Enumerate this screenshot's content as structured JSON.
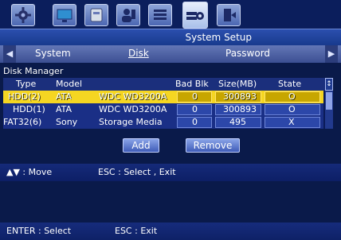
{
  "window": {
    "title": "System Setup"
  },
  "tabs": {
    "items": [
      "System",
      "Disk",
      "Password"
    ],
    "active": "Disk"
  },
  "disk_manager": {
    "title": "Disk Manager",
    "columns": [
      "Type",
      "Model",
      "Bad Blk",
      "Size(MB)",
      "State"
    ],
    "rows": [
      {
        "type": "HDD(2)",
        "model_vendor": "ATA",
        "model_name": "WDC WD3200A",
        "bad_blk": "0",
        "size_mb": "300893",
        "state": "O",
        "selected": true
      },
      {
        "type": "HDD(1)",
        "model_vendor": "ATA",
        "model_name": "WDC WD3200A",
        "bad_blk": "0",
        "size_mb": "300893",
        "state": "O",
        "selected": false
      },
      {
        "type": "FAT32(6)",
        "model_vendor": "Sony",
        "model_name": "Storage Media",
        "bad_blk": "0",
        "size_mb": "495",
        "state": "X",
        "selected": false
      }
    ]
  },
  "buttons": {
    "add": "Add",
    "remove": "Remove"
  },
  "help": {
    "move": "▲▼ : Move",
    "esc_select_exit": "ESC : Select , Exit",
    "enter_select": "ENTER : Select",
    "esc_exit": "ESC : Exit"
  },
  "icons": [
    "settings-gear-icon",
    "monitor-icon",
    "hdd-icon",
    "user-icon",
    "list-icon",
    "device-settings-icon",
    "exit-door-icon"
  ],
  "colors": {
    "selected_row": "#f5d622",
    "background": "#0a1a4a",
    "title_bar": "#2b4fae"
  }
}
